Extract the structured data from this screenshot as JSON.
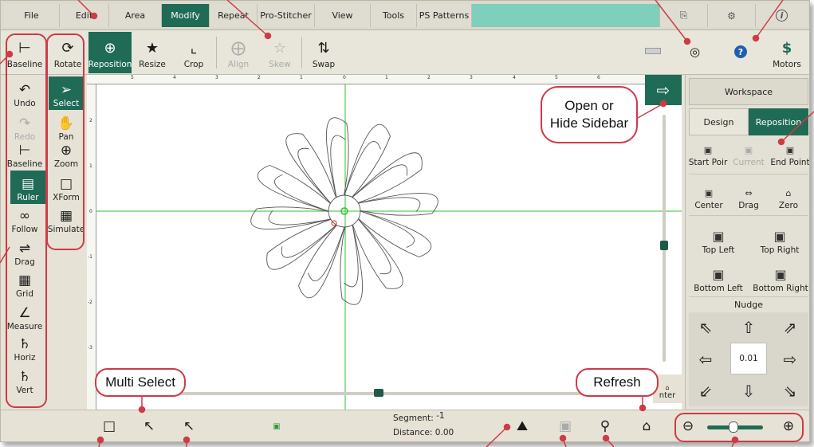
{
  "menu": {
    "items": [
      {
        "key": "file",
        "label": "File"
      },
      {
        "key": "edit",
        "label": "Edit"
      },
      {
        "key": "area",
        "label": "Area"
      },
      {
        "key": "modify",
        "label": "Modify",
        "active": true
      },
      {
        "key": "repeat",
        "label": "Repeat"
      },
      {
        "key": "pro-stitcher",
        "label": "Pro-Stitcher"
      },
      {
        "key": "view",
        "label": "View"
      },
      {
        "key": "tools",
        "label": "Tools"
      },
      {
        "key": "ps-patterns",
        "label": "PS Patterns"
      }
    ],
    "right_icons": [
      "keyboard-icon",
      "settings-icon",
      "info-icon"
    ]
  },
  "toolbar": {
    "rotate": "Rotate",
    "reposition": "Reposition",
    "resize": "Resize",
    "crop": "Crop",
    "align": "Align",
    "skew": "Skew",
    "swap": "Swap",
    "motors": "Motors",
    "motors_icon": "$"
  },
  "left_tools": {
    "baseline_top": "Baseline",
    "undo": "Undo",
    "redo": "Redo",
    "baseline": "Baseline",
    "ruler": "Ruler",
    "follow": "Follow",
    "drag": "Drag",
    "grid": "Grid",
    "measure": "Measure",
    "horiz": "Horiz",
    "vert": "Vert",
    "select": "Select",
    "pan": "Pan",
    "zoom": "Zoom",
    "xform": "XForm",
    "simulate": "Simulate"
  },
  "ruler": {
    "top_ticks": [
      "5",
      "4",
      "3",
      "2",
      "1",
      "0",
      "1",
      "2",
      "3",
      "4",
      "5",
      "6"
    ],
    "left_ticks": [
      "2",
      "1",
      "0",
      "-1",
      "-2",
      "-3"
    ]
  },
  "sidebar": {
    "workspace": "Workspace",
    "tab_design": "Design",
    "tab_reposition": "Reposition",
    "start_point": "Start Poir",
    "current": "Current",
    "end_point": "End Point",
    "center": "Center",
    "drag": "Drag",
    "zero": "Zero",
    "top_left": "Top Left",
    "top_right": "Top Right",
    "bottom_left": "Bottom Left",
    "bottom_right": "Bottom Right",
    "nudge": "Nudge",
    "nudge_value": "0.01"
  },
  "canvas": {
    "center_label_fragment": "nter"
  },
  "status": {
    "segment_label": "Segment:",
    "segment_value": "-1",
    "distance_label": "Distance:",
    "distance_value": "0.00"
  },
  "callouts": {
    "open_hide_sidebar": "Open or Hide Sidebar",
    "multi_select": "Multi Select",
    "refresh": "Refresh"
  },
  "colors": {
    "accent_green": "#1f6b55",
    "menu_teal": "#7ecfbc",
    "callout_red": "#cf3a47",
    "guide_green": "#2fc02f"
  }
}
